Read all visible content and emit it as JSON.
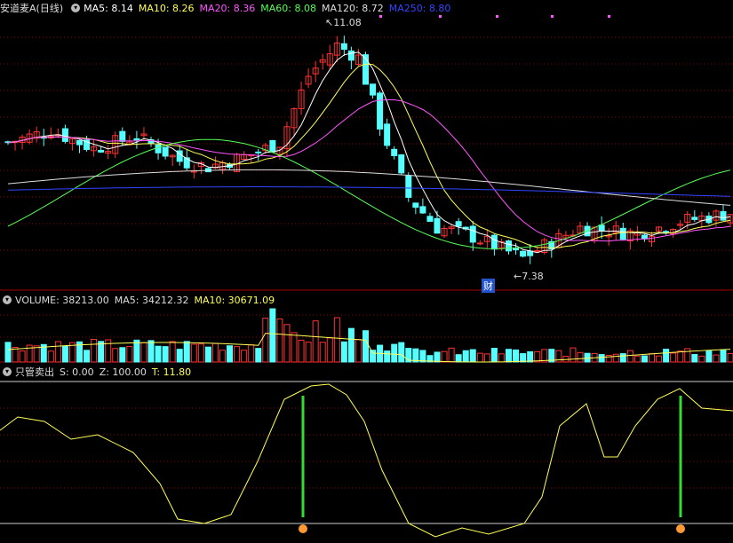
{
  "header": {
    "title": "安道麦A(日线)",
    "ma": [
      {
        "label": "MA5: 8.14",
        "color": "#ffffff"
      },
      {
        "label": "MA10: 8.26",
        "color": "#ffff55"
      },
      {
        "label": "MA20: 8.36",
        "color": "#ff55ff"
      },
      {
        "label": "MA60: 8.08",
        "color": "#55ff55"
      },
      {
        "label": "MA120: 8.72",
        "color": "#ffffff"
      },
      {
        "label": "MA250: 8.80",
        "color": "#3344ff"
      }
    ]
  },
  "volume_header": {
    "title": "VOLUME: 38213.00",
    "ma5": "MA5: 34212.32",
    "ma10": "MA10: 30671.09"
  },
  "indicator_header": {
    "title": "只管卖出",
    "s": "S: 0.00",
    "z": "Z: 100.00",
    "t": "T: 11.80"
  },
  "annotations": {
    "high": "11.08",
    "low": "7.38",
    "cai": "财"
  },
  "colors": {
    "up": "#ff3333",
    "down": "#55ffff",
    "grid": "#880000",
    "ma5": "#ffffff",
    "ma10": "#ffff55",
    "ma20": "#ff55ff",
    "ma60": "#55ff55",
    "ma120": "#dddddd",
    "ma250": "#3344ff",
    "osc": "#ffff55",
    "signal": "#33dd33"
  },
  "chart_data": [
    {
      "type": "line",
      "title": "安道麦A(日线)",
      "series": [
        {
          "name": "MA5",
          "last": 8.14
        },
        {
          "name": "MA10",
          "last": 8.26
        },
        {
          "name": "MA20",
          "last": 8.36
        },
        {
          "name": "MA60",
          "last": 8.08
        },
        {
          "name": "MA120",
          "last": 8.72
        },
        {
          "name": "MA250",
          "last": 8.8
        }
      ],
      "high_marker": 11.08,
      "low_marker": 7.38
    },
    {
      "type": "bar",
      "title": "VOLUME",
      "last_value": 38213.0,
      "ma5": 34212.32,
      "ma10": 30671.09
    },
    {
      "type": "line",
      "title": "只管卖出",
      "S": 0.0,
      "Z": 100.0,
      "T": 11.8
    }
  ]
}
